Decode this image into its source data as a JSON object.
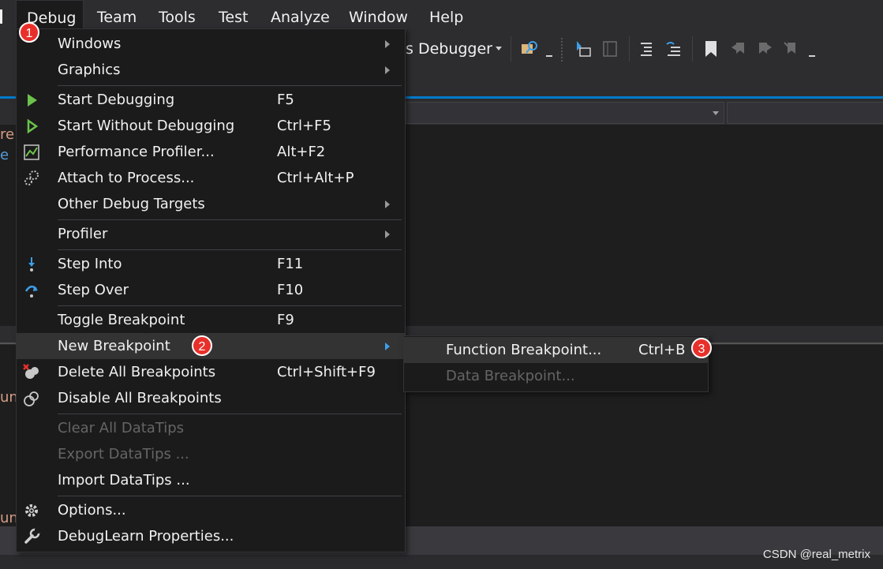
{
  "menubar": {
    "items": [
      "Debug",
      "Team",
      "Tools",
      "Test",
      "Analyze",
      "Window",
      "Help"
    ]
  },
  "toolbar": {
    "debugger_label": "s Debugger"
  },
  "debug_menu": {
    "items": [
      {
        "label": "Windows",
        "submenu": true
      },
      {
        "label": "Graphics",
        "submenu": true
      },
      {
        "label": "Start Debugging",
        "shortcut": "F5",
        "icon": "play-icon"
      },
      {
        "label": "Start Without Debugging",
        "shortcut": "Ctrl+F5",
        "icon": "play-outline-icon"
      },
      {
        "label": "Performance Profiler...",
        "shortcut": "Alt+F2",
        "icon": "profiler-icon"
      },
      {
        "label": "Attach to Process...",
        "shortcut": "Ctrl+Alt+P",
        "icon": "gears-icon"
      },
      {
        "label": "Other Debug Targets",
        "submenu": true
      },
      {
        "label": "Profiler",
        "submenu": true
      },
      {
        "label": "Step Into",
        "shortcut": "F11",
        "icon": "step-into-icon"
      },
      {
        "label": "Step Over",
        "shortcut": "F10",
        "icon": "step-over-icon"
      },
      {
        "label": "Toggle Breakpoint",
        "shortcut": "F9"
      },
      {
        "label": "New Breakpoint",
        "submenu": true,
        "highlighted": true
      },
      {
        "label": "Delete All Breakpoints",
        "shortcut": "Ctrl+Shift+F9",
        "icon": "delete-breakpoints-icon"
      },
      {
        "label": "Disable All Breakpoints",
        "icon": "disable-breakpoints-icon"
      },
      {
        "label": "Clear All DataTips",
        "disabled": true
      },
      {
        "label": "Export DataTips ...",
        "disabled": true
      },
      {
        "label": "Import DataTips ..."
      },
      {
        "label": "Options...",
        "icon": "gear-icon"
      },
      {
        "label": "DebugLearn Properties...",
        "icon": "wrench-icon"
      }
    ]
  },
  "submenu": {
    "items": [
      {
        "label": "Function Breakpoint...",
        "shortcut": "Ctrl+B",
        "highlighted": true
      },
      {
        "label": "Data Breakpoint...",
        "disabled": true
      }
    ]
  },
  "badges": [
    "1",
    "2",
    "3"
  ],
  "editor_fragments": {
    "line1": "re",
    "line2": "e",
    "line3": "un",
    "line4": "un"
  },
  "watermark": "CSDN @real_metrix",
  "colors": {
    "accent": "#007acc",
    "badge": "#e8302a",
    "menu_bg": "#1b1b1c",
    "highlight": "#333334",
    "play_green": "#6cc24a",
    "step_blue": "#3c9fe8"
  }
}
